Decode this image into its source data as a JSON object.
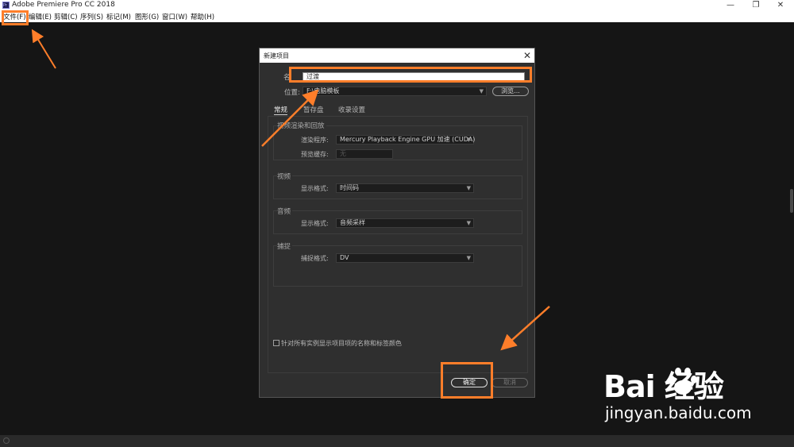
{
  "app": {
    "title": "Adobe Premiere Pro CC 2018",
    "icon": "premiere-pro-icon"
  },
  "window_controls": {
    "minimize": "—",
    "maximize": "❐",
    "close": "✕"
  },
  "menu": [
    "文件(F)",
    "编辑(E)",
    "剪辑(C)",
    "序列(S)",
    "标记(M)",
    "图形(G)",
    "窗口(W)",
    "帮助(H)"
  ],
  "dialog": {
    "title": "新建项目",
    "close_glyph": "✕",
    "name_label": "名",
    "name_value": "过渡",
    "location_label": "位置:",
    "location_value": "F:\\电脑模板",
    "browse_button": "浏览...",
    "tabs": [
      "常规",
      "暂存盘",
      "收录设置"
    ],
    "groups": {
      "video_render": {
        "title": "视频渲染和回放",
        "renderer_label": "渲染程序:",
        "renderer_value": "Mercury Playback Engine GPU 加速 (CUDA)",
        "preview_cache_label": "预览缓存:",
        "preview_cache_value": "无"
      },
      "video": {
        "title": "视频",
        "display_format_label": "显示格式:",
        "display_format_value": "时间码"
      },
      "audio": {
        "title": "音频",
        "display_format_label": "显示格式:",
        "display_format_value": "音频采样"
      },
      "capture": {
        "title": "捕捉",
        "capture_format_label": "捕捉格式:",
        "capture_format_value": "DV"
      }
    },
    "checkbox_label": "针对所有实例显示项目项的名称和标签颜色",
    "checkbox_checked": false,
    "ok_button": "确定",
    "cancel_button": "取消"
  },
  "annotations": {
    "highlight_color": "#ff7e2a"
  },
  "watermark": {
    "logo": "Bai  经验",
    "url": "jingyan.baidu.com"
  }
}
